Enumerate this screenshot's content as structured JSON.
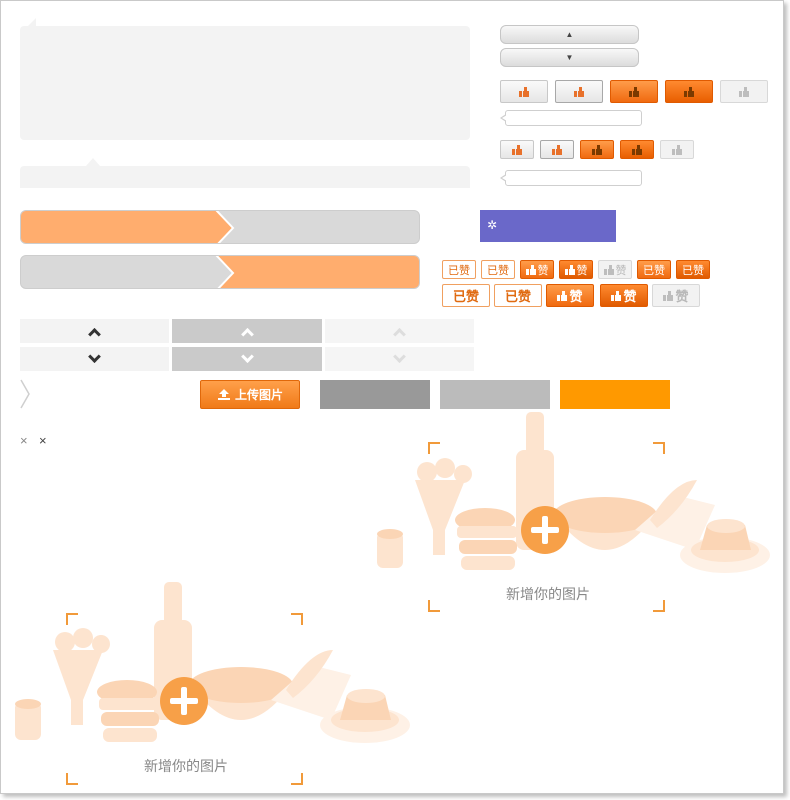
{
  "upload": {
    "icon": "upload-icon",
    "label": "上传图片"
  },
  "badges_small": [
    "已赞",
    "已赞",
    "赞",
    "赞",
    "赞",
    "已赞",
    "已赞"
  ],
  "badges_large": [
    "已赞",
    "已赞",
    "赞",
    "赞",
    "赞"
  ],
  "purple_box": {
    "icon": "gear-icon",
    "glyph": "✲"
  },
  "close_icons": [
    "×",
    "×"
  ],
  "add_photo": {
    "label": "新增你的图片"
  },
  "colors": {
    "orange": "#ff9900",
    "accent": "#f07a18",
    "purple": "#6a68c9",
    "light_orange": "#ffad6e"
  }
}
